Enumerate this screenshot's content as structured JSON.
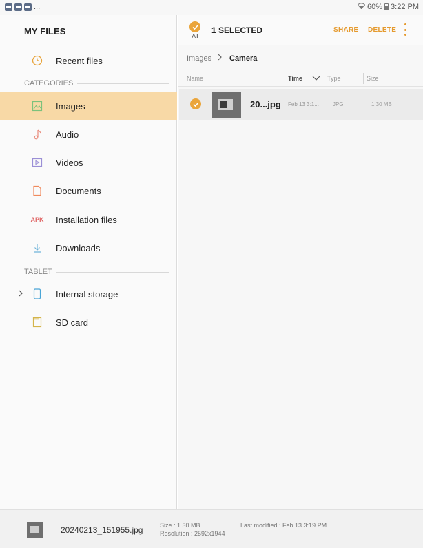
{
  "status": {
    "more": "...",
    "battery": "60%",
    "time": "3:22 PM"
  },
  "sidebar": {
    "title": "MY FILES",
    "recent_label": "Recent files",
    "categories_label": "CATEGORIES",
    "categories": [
      {
        "label": "Images",
        "icon": "image-icon",
        "selected": true
      },
      {
        "label": "Audio",
        "icon": "music-note-icon"
      },
      {
        "label": "Videos",
        "icon": "video-icon"
      },
      {
        "label": "Documents",
        "icon": "document-icon"
      },
      {
        "label": "Installation files",
        "icon": "apk-icon",
        "icon_text": "APK"
      },
      {
        "label": "Downloads",
        "icon": "download-icon"
      }
    ],
    "tablet_label": "TABLET",
    "storage": [
      {
        "label": "Internal storage",
        "icon": "tablet-icon"
      },
      {
        "label": "SD card",
        "icon": "sd-card-icon"
      }
    ]
  },
  "toolbar": {
    "all_label": "All",
    "selected_text": "1 SELECTED",
    "share_label": "SHARE",
    "delete_label": "DELETE"
  },
  "breadcrumb": {
    "root": "Images",
    "current": "Camera"
  },
  "columns": {
    "name": "Name",
    "time": "Time",
    "type": "Type",
    "size": "Size"
  },
  "files": [
    {
      "name": "20...jpg",
      "time": "Feb 13 3:1...",
      "type": "JPG",
      "size": "1.30 MB",
      "selected": true
    }
  ],
  "footer": {
    "file_name": "20240213_151955.jpg",
    "size": "Size : 1.30 MB",
    "resolution": "Resolution : 2592x1944",
    "modified": "Last modified : Feb 13 3:19 PM"
  },
  "colors": {
    "accent": "#eaa53b",
    "action": "#e59a2e",
    "selected_bg": "#f8d9a6"
  }
}
